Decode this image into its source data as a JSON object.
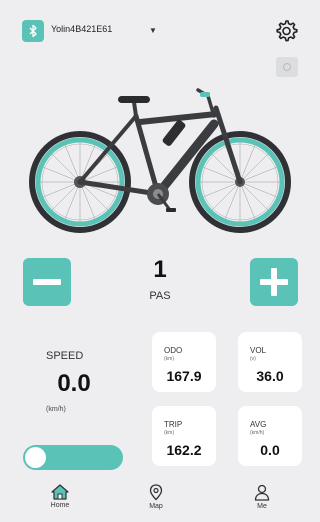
{
  "header": {
    "device_name": "Yolin4B421E61",
    "bluetooth_icon": "bluetooth-icon",
    "settings_icon": "gear-icon"
  },
  "pas": {
    "value": "1",
    "label": "PAS"
  },
  "speed": {
    "label": "SPEED",
    "value": "0.0",
    "unit": "(km/h)"
  },
  "stats": {
    "odo": {
      "label": "ODO",
      "unit": "(km)",
      "value": "167.9"
    },
    "vol": {
      "label": "VOL",
      "unit": "(v)",
      "value": "36.0"
    },
    "trip": {
      "label": "TRIP",
      "unit": "(km)",
      "value": "162.2"
    },
    "avg": {
      "label": "AVG",
      "unit": "(km/h)",
      "value": "0.0"
    }
  },
  "toggle": {
    "on": true
  },
  "nav": {
    "home": "Home",
    "map": "Map",
    "me": "Me"
  },
  "colors": {
    "accent": "#5bc2b8",
    "background": "#eeeef0",
    "frame": "#3a3c40"
  }
}
